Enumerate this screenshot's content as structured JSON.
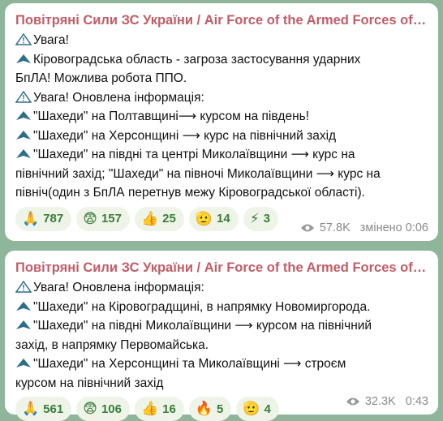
{
  "messages": [
    {
      "channel": "Повітряні Сили ЗС України / Air Force of the Armed Forces of U...",
      "lines": [
        {
          "icon": "warning-sign-icon",
          "text": "Увага!"
        },
        {
          "icon": "drone-icon",
          "text": "Кіровоградська область - загроза застосування ударних"
        },
        {
          "icon": "",
          "text": "БпЛА! Можлива робота ППО."
        },
        {
          "icon": "warning-sign-icon",
          "text": "Увага! Оновлена інформація:"
        },
        {
          "icon": "drone-icon",
          "text": "\"Шахеди\" на Полтавщині⟶ курсом на південь!"
        },
        {
          "icon": "drone-icon",
          "text": "\"Шахеди\" на Херсонщині ⟶ курс на північний захід"
        },
        {
          "icon": "drone-icon",
          "text": "\"Шахеди\" на півдні та центрі Миколаївщини ⟶ курс на"
        },
        {
          "icon": "",
          "text": "північний захід; \"Шахеди\" на півночі Миколаївщини ⟶ курс на"
        },
        {
          "icon": "",
          "text": "північ(один з БпЛА перетнув межу Кіровоградської області)."
        }
      ],
      "reactions": [
        {
          "emoji": "🙏",
          "count": "787"
        },
        {
          "emoji": "😨",
          "count": "157"
        },
        {
          "emoji": "👍",
          "count": "25"
        },
        {
          "emoji": "🫡",
          "count": "14"
        },
        {
          "emoji": "⚡",
          "count": "3"
        }
      ],
      "views": "57.8K",
      "time": "змінено 0:06"
    },
    {
      "channel": "Повітряні Сили ЗС України / Air Force of the Armed Forces of U...",
      "lines": [
        {
          "icon": "warning-sign-icon",
          "text": "Увага! Оновлена інформація:"
        },
        {
          "icon": "drone-icon",
          "text": "\"Шахеди\" на Кіровоградщині, в напрямку Новомиргорода."
        },
        {
          "icon": "drone-icon",
          "text": "\"Шахеди\" на півдні  Миколаївщини ⟶ курсом на північний"
        },
        {
          "icon": "",
          "text": "захід, в напрямку Первомайська."
        },
        {
          "icon": "drone-icon",
          "text": "\"Шахеди\" на  Херсонщині та Миколаївщині ⟶ строєм"
        },
        {
          "icon": "",
          "text": "курсом на північний захід"
        }
      ],
      "reactions": [
        {
          "emoji": "🙏",
          "count": "561"
        },
        {
          "emoji": "😨",
          "count": "106"
        },
        {
          "emoji": "👍",
          "count": "16"
        },
        {
          "emoji": "🔥",
          "count": "5"
        },
        {
          "emoji": "🫡",
          "count": "4"
        }
      ],
      "views": "32.3K",
      "time": "0:43"
    }
  ]
}
